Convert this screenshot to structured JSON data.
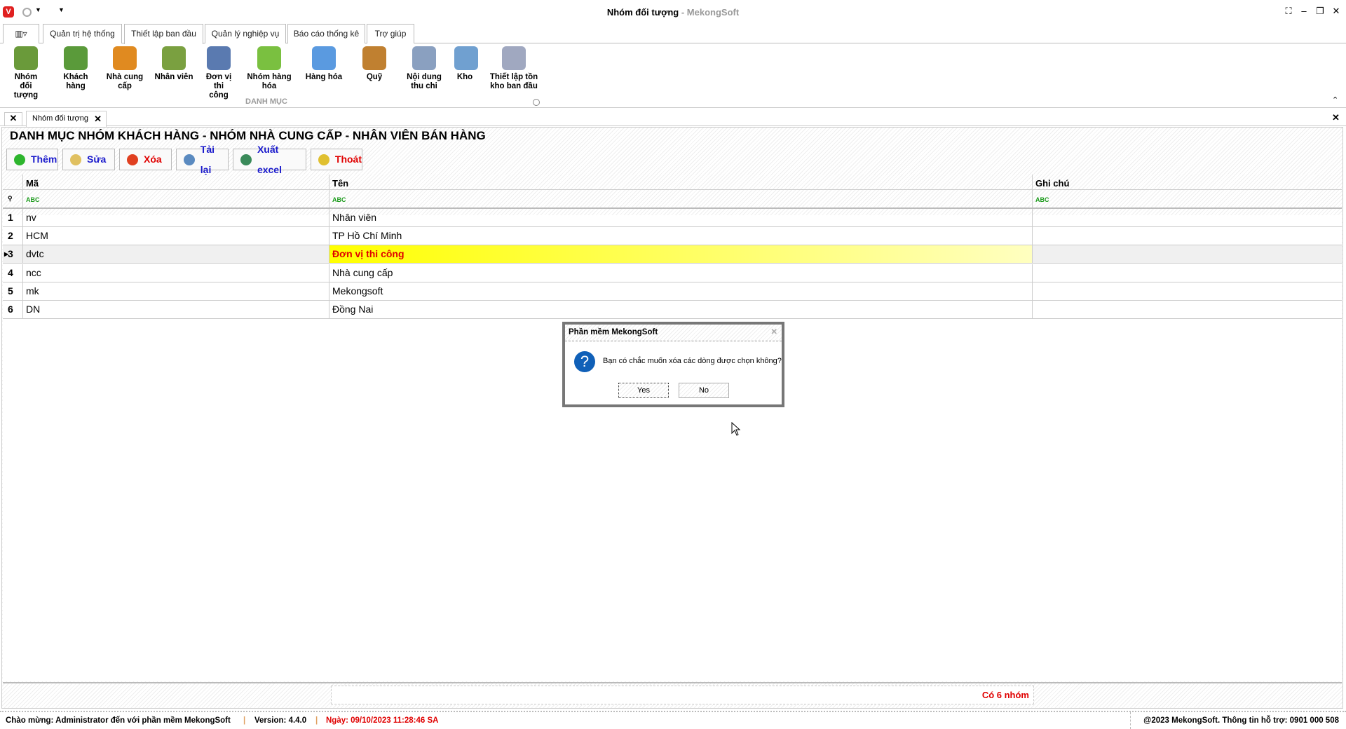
{
  "window": {
    "title": "Nhóm đối tượng",
    "app_name": "MekongSoft",
    "separator": " - "
  },
  "ribbon_tabs": [
    "Quản trị hệ thống",
    "Thiết lập ban đầu",
    "Quản lý nghiệp vụ",
    "Báo cáo thống kê",
    "Trợ giúp"
  ],
  "ribbon_active_tab": "Thiết lập ban đầu",
  "ribbon_items": [
    {
      "label": "Nhóm đối tượng",
      "icon": "people-group-icon",
      "color": "#6a9a3a"
    },
    {
      "label": "Khách hàng",
      "icon": "customer-icon",
      "color": "#5a9a3a"
    },
    {
      "label": "Nhà cung cấp",
      "icon": "supplier-icon",
      "color": "#e08a20"
    },
    {
      "label": "Nhân viên",
      "icon": "employee-icon",
      "color": "#7aa040"
    },
    {
      "label": "Đơn vị thi công",
      "icon": "worker-icon",
      "color": "#5a7ab0"
    },
    {
      "label": "Nhóm hàng hóa",
      "icon": "product-group-icon",
      "color": "#7ac040"
    },
    {
      "label": "Hàng hóa",
      "icon": "star-icon",
      "color": "#5a9ae0"
    },
    {
      "label": "Quỹ",
      "icon": "coins-icon",
      "color": "#c08030"
    },
    {
      "label": "Nội dung thu chi",
      "icon": "document-add-icon",
      "color": "#8aa0c0"
    },
    {
      "label": "Kho",
      "icon": "house-icon",
      "color": "#70a0d0"
    },
    {
      "label": "Thiết lập tồn kho ban đầu",
      "icon": "columns-icon",
      "color": "#a0a8c0"
    }
  ],
  "ribbon_group": "DANH MỤC",
  "doc_tab": "Nhóm đối tượng",
  "heading": "DANH MỤC NHÓM KHÁCH HÀNG - NHÓM NHÀ CUNG CẤP - NHÂN VIÊN BÁN HÀNG",
  "toolbar": [
    {
      "label": "Thêm",
      "color": "#1a1acc",
      "icon": "plus-icon",
      "icon_color": "#2db52d"
    },
    {
      "label": "Sửa",
      "color": "#1a1acc",
      "icon": "pencil-icon",
      "icon_color": "#e0c060"
    },
    {
      "label": "Xóa",
      "color": "#e00000",
      "icon": "minus-icon",
      "icon_color": "#e04020"
    },
    {
      "label": "Tải lại",
      "color": "#1a1acc",
      "icon": "refresh-icon",
      "icon_color": "#5a8ac0"
    },
    {
      "label": "Xuất excel",
      "color": "#1a1acc",
      "icon": "excel-icon",
      "icon_color": "#3a8a5a"
    },
    {
      "label": "Thoát",
      "color": "#e00000",
      "icon": "exit-icon",
      "icon_color": "#e0c030"
    }
  ],
  "grid": {
    "columns": [
      "Mã",
      "Tên",
      "Ghi chú"
    ],
    "rows": [
      {
        "n": "1",
        "ma": "nv",
        "ten": "Nhân viên",
        "ghichu": ""
      },
      {
        "n": "2",
        "ma": "HCM",
        "ten": "TP Hồ Chí Minh",
        "ghichu": ""
      },
      {
        "n": "3",
        "ma": "dvtc",
        "ten": "Đơn vị thi công",
        "ghichu": "",
        "selected": true
      },
      {
        "n": "4",
        "ma": "ncc",
        "ten": "Nhà cung cấp",
        "ghichu": ""
      },
      {
        "n": "5",
        "ma": "mk",
        "ten": "Mekongsoft",
        "ghichu": ""
      },
      {
        "n": "6",
        "ma": "DN",
        "ten": "Đồng Nai",
        "ghichu": ""
      }
    ],
    "summary": "Có 6 nhóm"
  },
  "dialog": {
    "title": "Phần mềm MekongSoft",
    "message": "Bạn có chắc muốn xóa các dòng được chọn không?",
    "yes": "Yes",
    "no": "No"
  },
  "status": {
    "welcome": "Chào mừng: Administrator đến với phần mềm MekongSoft",
    "version": "Version: 4.4.0",
    "date": "Ngày: 09/10/2023 11:28:46 SA",
    "copyright": "@2023 MekongSoft. Thông tin hỗ trợ: 0901 000 508"
  }
}
